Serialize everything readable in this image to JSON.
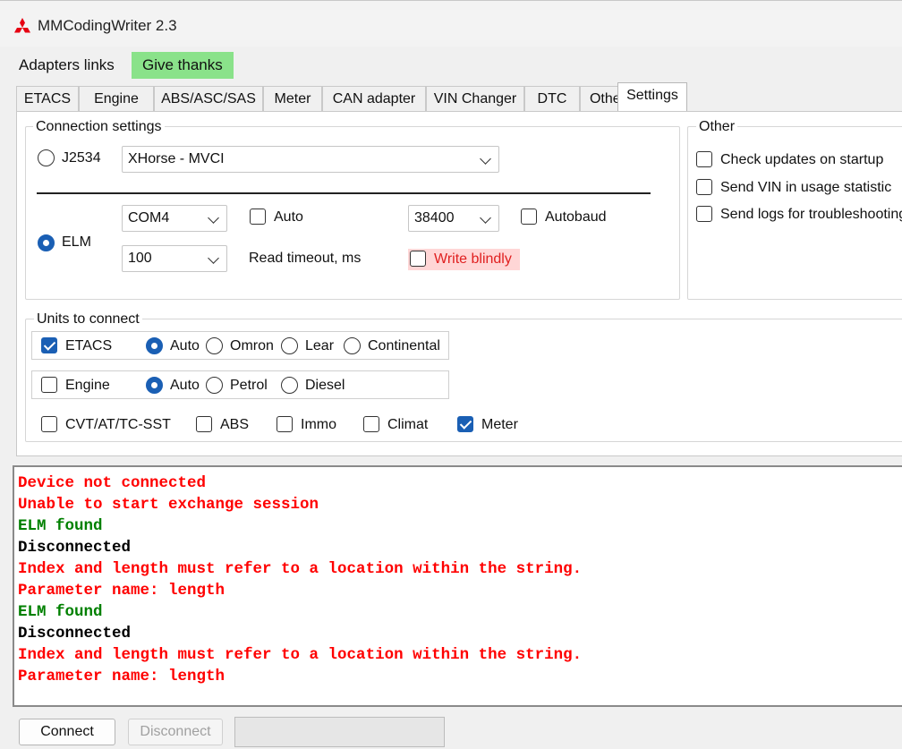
{
  "window": {
    "title": "MMCodingWriter 2.3",
    "logo_icon": "mitsubishi-logo-icon",
    "logo_color": "#e60012"
  },
  "menu": {
    "adapters_links": "Adapters links",
    "give_thanks": "Give thanks",
    "give_thanks_color": "#8ae28a"
  },
  "tabs": [
    "ETACS",
    "Engine",
    "ABS/ASC/SAS",
    "Meter",
    "CAN adapter",
    "VIN Changer",
    "DTC",
    "Other",
    "Settings"
  ],
  "active_tab": "Settings",
  "connection": {
    "group_title": "Connection settings",
    "j2534_label": "J2534",
    "j2534_selected": false,
    "j2534_device": "XHorse - MVCI",
    "elm_label": "ELM",
    "elm_selected": true,
    "com_port": "COM4",
    "auto_label": "Auto",
    "auto_checked": false,
    "baud_rate": "38400",
    "autobaud_label": "Autobaud",
    "autobaud_checked": false,
    "timeout_value": "100",
    "timeout_label": "Read timeout, ms",
    "write_blindly_label": "Write blindly",
    "write_blindly_checked": false,
    "write_blindly_bg": "#ffd6d6",
    "write_blindly_color": "#e02020"
  },
  "other": {
    "group_title": "Other",
    "check_updates": "Check updates on startup",
    "send_vin": "Send VIN in usage statistic",
    "send_logs": "Send logs for troubleshooting"
  },
  "units": {
    "group_title": "Units to connect",
    "etacs": {
      "label": "ETACS",
      "checked": true,
      "options": [
        "Auto",
        "Omron",
        "Lear",
        "Continental"
      ],
      "selected": "Auto"
    },
    "engine": {
      "label": "Engine",
      "checked": false,
      "options": [
        "Auto",
        "Petrol",
        "Diesel"
      ],
      "selected": "Auto"
    },
    "extras": [
      {
        "label": "CVT/AT/TC-SST",
        "checked": false
      },
      {
        "label": "ABS",
        "checked": false
      },
      {
        "label": "Immo",
        "checked": false
      },
      {
        "label": "Climat",
        "checked": false
      },
      {
        "label": "Meter",
        "checked": true
      }
    ]
  },
  "log": [
    {
      "text": "Device not connected",
      "color": "#ff0000"
    },
    {
      "text": "Unable to start exchange session",
      "color": "#ff0000"
    },
    {
      "text": "ELM found",
      "color": "#008000"
    },
    {
      "text": "Disconnected",
      "color": "#000000"
    },
    {
      "text": "Index and length must refer to a location within the string.",
      "color": "#ff0000"
    },
    {
      "text": "Parameter name: length",
      "color": "#ff0000"
    },
    {
      "text": "ELM found",
      "color": "#008000"
    },
    {
      "text": "Disconnected",
      "color": "#000000"
    },
    {
      "text": "Index and length must refer to a location within the string.",
      "color": "#ff0000"
    },
    {
      "text": "Parameter name: length",
      "color": "#ff0000"
    }
  ],
  "footer": {
    "connect": "Connect",
    "disconnect": "Disconnect",
    "progress": 0
  }
}
